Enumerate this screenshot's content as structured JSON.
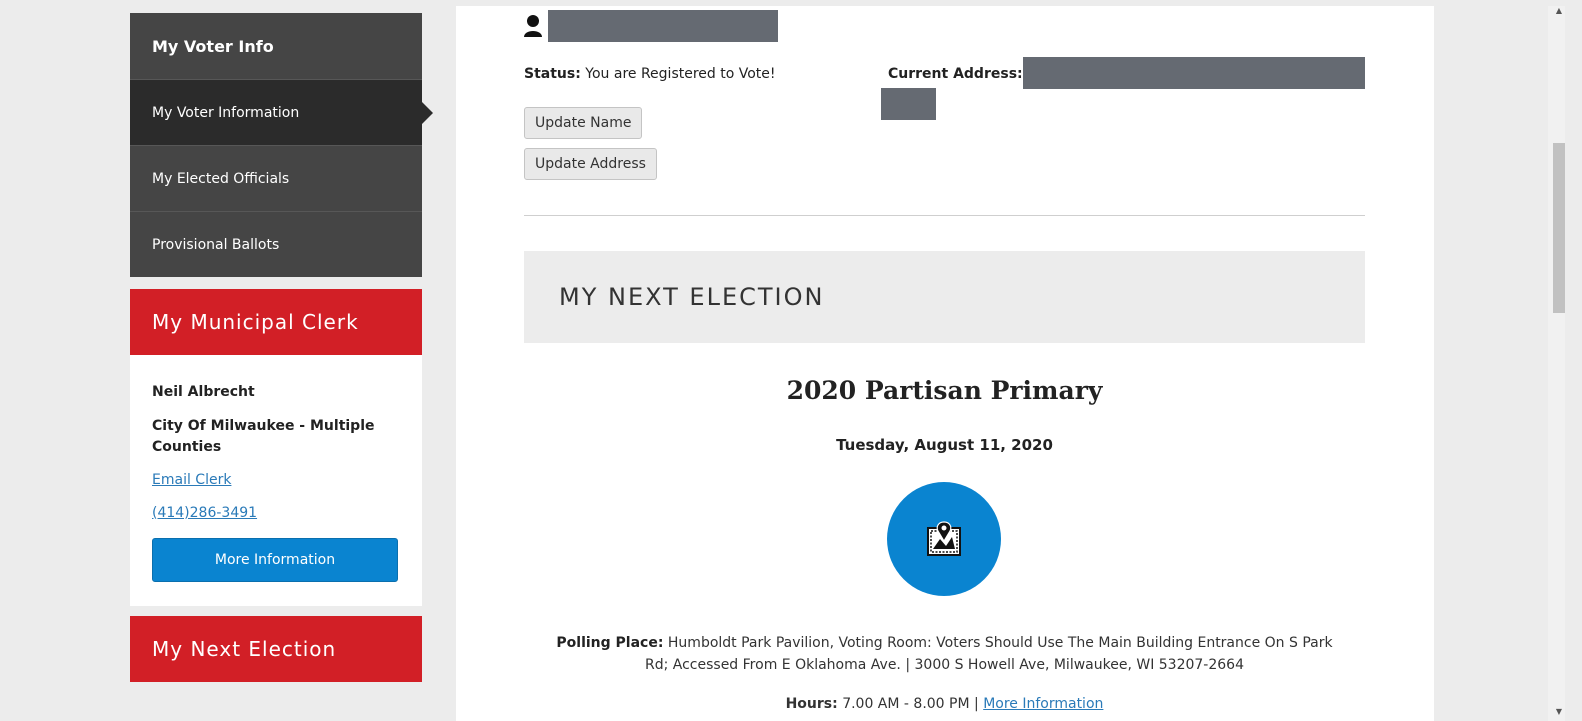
{
  "sidebar": {
    "header": "My Voter Info",
    "items": [
      {
        "label": "My Voter Information",
        "active": true
      },
      {
        "label": "My Elected Officials",
        "active": false
      },
      {
        "label": "Provisional Ballots",
        "active": false
      }
    ],
    "clerk_header": "My Municipal Clerk",
    "clerk": {
      "name": "Neil Albrecht",
      "municipality": "City Of Milwaukee - Multiple Counties",
      "email_link": "Email Clerk",
      "phone": "(414)286-3491",
      "more_button": "More Information"
    },
    "next_election_header": "My Next Election"
  },
  "main": {
    "status_label": "Status:",
    "status_value": "You are Registered to Vote!",
    "current_address_label": "Current Address:",
    "update_name_button": "Update Name",
    "update_address_button": "Update Address",
    "next_election_heading": "MY NEXT ELECTION",
    "election_title": "2020 Partisan Primary",
    "election_date": "Tuesday, August 11, 2020",
    "polling_label": "Polling Place:",
    "polling_line1": "Humboldt Park Pavilion, Voting Room: Voters Should Use The Main Building Entrance On S Park",
    "polling_line2": "Rd; Accessed From E Oklahoma Ave. | 3000 S Howell Ave, Milwaukee, WI  53207-2664",
    "hours_label": "Hours:",
    "hours_value": "7.00 AM - 8.00 PM |",
    "hours_link": "More Information"
  },
  "colors": {
    "brand_red": "#d21f26",
    "accent_blue": "#0a84d0",
    "nav_dark": "#454545",
    "redaction_grey": "#656a72"
  },
  "icons": [
    "user-icon",
    "map-pin-icon"
  ]
}
